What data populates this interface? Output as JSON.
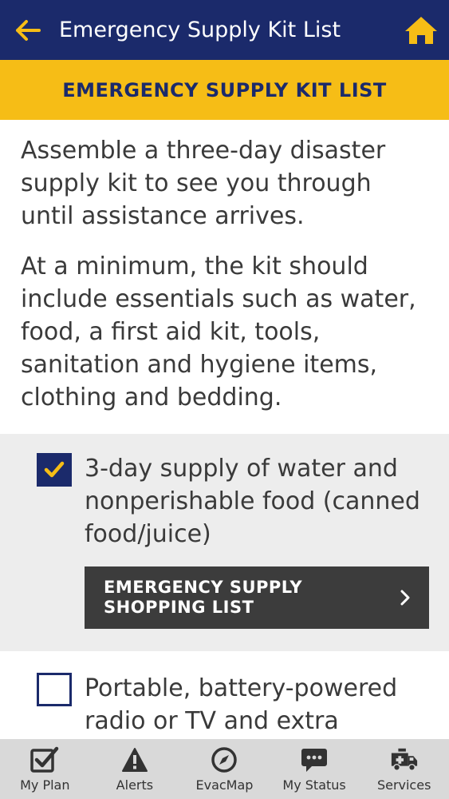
{
  "header": {
    "title": "Emergency Supply Kit List",
    "back_icon": "back-arrow-icon",
    "home_icon": "home-icon",
    "bar_color": "#1b2a6b",
    "accent_color": "#f6bd16"
  },
  "banner": {
    "title": "EMERGENCY SUPPLY KIT LIST"
  },
  "intro": {
    "paragraph1": "Assemble a three-day disaster supply kit to see you through until assistance arrives.",
    "paragraph2": "At a minimum, the kit should include essentials such as water, food, a first aid kit, tools, sanitation and hygiene items, clothing and bedding."
  },
  "items": [
    {
      "text": "3-day supply of water and nonperishable food (canned food/juice)",
      "checked": true,
      "button_label": "EMERGENCY SUPPLY\nSHOPPING LIST"
    },
    {
      "text": "Portable, battery-powered radio or TV and extra",
      "checked": false
    }
  ],
  "tabs": [
    {
      "label": "My Plan",
      "icon": "checklist-icon"
    },
    {
      "label": "Alerts",
      "icon": "warning-icon"
    },
    {
      "label": "EvacMap",
      "icon": "compass-icon"
    },
    {
      "label": "My Status",
      "icon": "chat-bubble-icon"
    },
    {
      "label": "Services",
      "icon": "ambulance-icon"
    }
  ]
}
